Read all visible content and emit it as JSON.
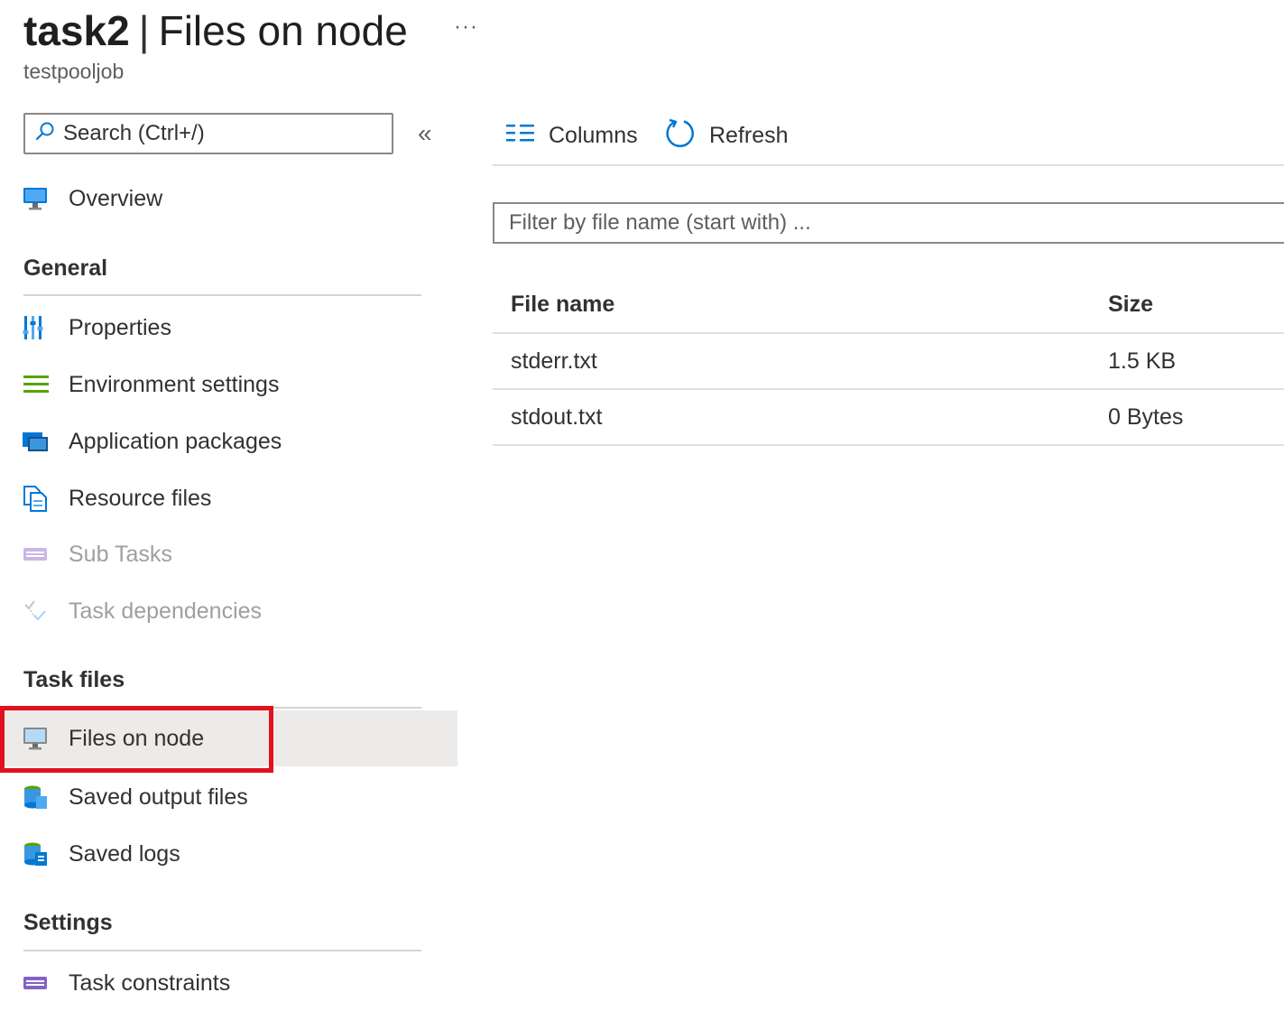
{
  "header": {
    "title_main": "task2",
    "title_separator": "|",
    "title_sub": "Files on node",
    "more_label": "···",
    "subtitle": "testpooljob"
  },
  "sidebar": {
    "search_placeholder": "Search (Ctrl+/)",
    "collapse_label": "«",
    "overview": {
      "label": "Overview",
      "icon": "overview-monitor-icon"
    },
    "sections": [
      {
        "title": "General",
        "items": [
          {
            "label": "Properties",
            "icon": "properties-bars-icon",
            "disabled": false
          },
          {
            "label": "Environment settings",
            "icon": "environment-list-icon",
            "disabled": false
          },
          {
            "label": "Application packages",
            "icon": "application-packages-icon",
            "disabled": false
          },
          {
            "label": "Resource files",
            "icon": "resource-files-icon",
            "disabled": true
          }
        ]
      }
    ],
    "general_title": "General",
    "general_items": [
      {
        "label": "Properties",
        "icon": "properties-bars-icon",
        "disabled": false
      },
      {
        "label": "Environment settings",
        "icon": "environment-list-icon",
        "disabled": false
      },
      {
        "label": "Application packages",
        "icon": "application-packages-icon",
        "disabled": false
      },
      {
        "label": "Resource files",
        "icon": "resource-files-icon",
        "disabled": false
      },
      {
        "label": "Sub Tasks",
        "icon": "subtasks-icon",
        "disabled": true
      },
      {
        "label": "Task dependencies",
        "icon": "task-dependencies-icon",
        "disabled": true
      }
    ],
    "task_files_title": "Task files",
    "task_files_items": [
      {
        "label": "Files on node",
        "icon": "files-on-node-monitor-icon",
        "selected": true
      },
      {
        "label": "Saved output files",
        "icon": "saved-output-files-icon",
        "selected": false
      },
      {
        "label": "Saved logs",
        "icon": "saved-logs-icon",
        "selected": false
      }
    ],
    "settings_title": "Settings",
    "settings_items": [
      {
        "label": "Task constraints",
        "icon": "task-constraints-icon"
      }
    ]
  },
  "toolbar": {
    "columns_label": "Columns",
    "refresh_label": "Refresh"
  },
  "filter": {
    "placeholder": "Filter by file name (start with) ..."
  },
  "table": {
    "headers": [
      "File name",
      "Size"
    ],
    "rows": [
      [
        "stderr.txt",
        "1.5 KB"
      ],
      [
        "stdout.txt",
        "0 Bytes"
      ]
    ]
  },
  "colors": {
    "accent": "#0078d4",
    "selected_bg": "#edebe9",
    "highlight_border": "#e3101e",
    "disabled_text": "#a19f9d"
  }
}
